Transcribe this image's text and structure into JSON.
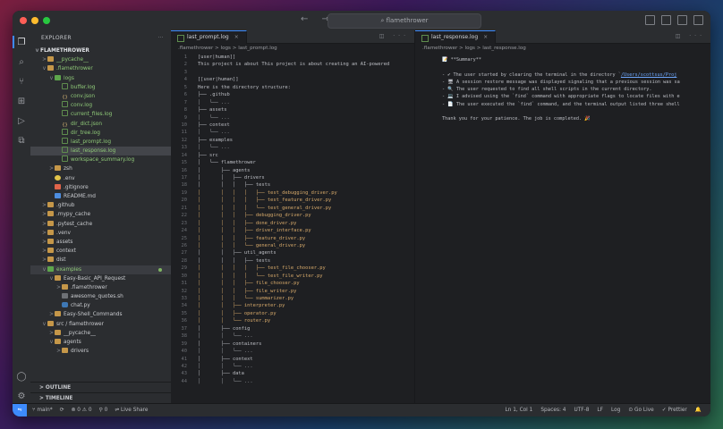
{
  "window": {
    "title": "flamethrower"
  },
  "sidebar": {
    "header": "EXPLORER",
    "project": "FLAMETHROWER",
    "tree": [
      {
        "label": "__pycache__",
        "depth": 1,
        "kind": "folder",
        "twisty": ">",
        "cls": "txt-green"
      },
      {
        "label": ".flamethrower",
        "depth": 1,
        "kind": "folder",
        "twisty": "v",
        "cls": "txt-green"
      },
      {
        "label": "logs",
        "depth": 2,
        "kind": "folder-green",
        "twisty": "v",
        "cls": "txt-green"
      },
      {
        "label": "buffer.log",
        "depth": 3,
        "kind": "log",
        "twisty": "",
        "cls": "txt-green"
      },
      {
        "label": "conv.json",
        "depth": 3,
        "kind": "json",
        "twisty": "",
        "cls": "txt-green"
      },
      {
        "label": "conv.log",
        "depth": 3,
        "kind": "log",
        "twisty": "",
        "cls": "txt-green"
      },
      {
        "label": "current_files.log",
        "depth": 3,
        "kind": "log",
        "twisty": "",
        "cls": "txt-green"
      },
      {
        "label": "dir_dict.json",
        "depth": 3,
        "kind": "json",
        "twisty": "",
        "cls": "txt-green"
      },
      {
        "label": "dir_tree.log",
        "depth": 3,
        "kind": "log",
        "twisty": "",
        "cls": "txt-green"
      },
      {
        "label": "last_prompt.log",
        "depth": 3,
        "kind": "log",
        "twisty": "",
        "cls": "txt-green"
      },
      {
        "label": "last_response.log",
        "depth": 3,
        "kind": "log",
        "twisty": "",
        "cls": "txt-green",
        "state": "sel"
      },
      {
        "label": "workspace_summary.log",
        "depth": 3,
        "kind": "log",
        "twisty": "",
        "cls": "txt-green"
      },
      {
        "label": "zsh",
        "depth": 2,
        "kind": "folder",
        "twisty": ">",
        "cls": ""
      },
      {
        "label": ".env",
        "depth": 2,
        "kind": "env",
        "twisty": "",
        "cls": ""
      },
      {
        "label": ".gitignore",
        "depth": 2,
        "kind": "git",
        "twisty": "",
        "cls": ""
      },
      {
        "label": "README.md",
        "depth": 2,
        "kind": "md",
        "twisty": "",
        "cls": ""
      },
      {
        "label": ".github",
        "depth": 1,
        "kind": "folder",
        "twisty": ">",
        "cls": ""
      },
      {
        "label": ".mypy_cache",
        "depth": 1,
        "kind": "folder",
        "twisty": ">",
        "cls": ""
      },
      {
        "label": ".pytest_cache",
        "depth": 1,
        "kind": "folder",
        "twisty": ">",
        "cls": ""
      },
      {
        "label": ".venv",
        "depth": 1,
        "kind": "folder",
        "twisty": ">",
        "cls": ""
      },
      {
        "label": "assets",
        "depth": 1,
        "kind": "folder",
        "twisty": ">",
        "cls": ""
      },
      {
        "label": "context",
        "depth": 1,
        "kind": "folder",
        "twisty": ">",
        "cls": ""
      },
      {
        "label": "dist",
        "depth": 1,
        "kind": "folder",
        "twisty": ">",
        "cls": ""
      },
      {
        "label": "examples",
        "depth": 1,
        "kind": "folder-green",
        "twisty": "v",
        "cls": "txt-green",
        "state": "hi",
        "badge": true
      },
      {
        "label": "Easy-Basic_API_Request",
        "depth": 2,
        "kind": "folder",
        "twisty": "v",
        "cls": ""
      },
      {
        "label": ".flamethrower",
        "depth": 3,
        "kind": "folder",
        "twisty": ">",
        "cls": ""
      },
      {
        "label": "awesome_quotes.sh",
        "depth": 3,
        "kind": "sh",
        "twisty": "",
        "cls": ""
      },
      {
        "label": "chat.py",
        "depth": 3,
        "kind": "py",
        "twisty": "",
        "cls": ""
      },
      {
        "label": "Easy-Shell_Commands",
        "depth": 2,
        "kind": "folder",
        "twisty": ">",
        "cls": ""
      },
      {
        "label": "src / flamethrower",
        "depth": 1,
        "kind": "folder",
        "twisty": "v",
        "cls": ""
      },
      {
        "label": "__pycache__",
        "depth": 2,
        "kind": "folder",
        "twisty": ">",
        "cls": ""
      },
      {
        "label": "agents",
        "depth": 2,
        "kind": "folder",
        "twisty": "v",
        "cls": ""
      },
      {
        "label": "drivers",
        "depth": 3,
        "kind": "folder",
        "twisty": ">",
        "cls": ""
      }
    ],
    "outline_label": "OUTLINE",
    "timeline_label": "TIMELINE"
  },
  "left_editor": {
    "tab": "last_prompt.log",
    "breadcrumb": ".flamethrower  >  logs  >  last_prompt.log",
    "lines": [
      {
        "n": "1",
        "t": "[user|human]]",
        "c": ""
      },
      {
        "n": "2",
        "t": "This project is about This project is about creating an AI-powered",
        "c": ""
      },
      {
        "n": "3",
        "t": "",
        "c": ""
      },
      {
        "n": "4",
        "t": "[[user|human]]",
        "c": ""
      },
      {
        "n": "5",
        "t": "Here is the directory structure:",
        "c": ""
      },
      {
        "n": "6",
        "t": "├── .github",
        "c": "folder"
      },
      {
        "n": "7",
        "t": "│   └── ...",
        "c": "tree"
      },
      {
        "n": "8",
        "t": "├── assets",
        "c": "folder"
      },
      {
        "n": "9",
        "t": "│   └── ...",
        "c": "tree"
      },
      {
        "n": "10",
        "t": "├── context",
        "c": "folder"
      },
      {
        "n": "11",
        "t": "│   └── ...",
        "c": "tree"
      },
      {
        "n": "12",
        "t": "├── examples",
        "c": "folder"
      },
      {
        "n": "13",
        "t": "│   └── ...",
        "c": "tree"
      },
      {
        "n": "14",
        "t": "├── src",
        "c": "folder"
      },
      {
        "n": "15",
        "t": "│   └── flamethrower",
        "c": "folder"
      },
      {
        "n": "16",
        "t": "│       ├── agents",
        "c": "folder"
      },
      {
        "n": "17",
        "t": "│       │   ├── drivers",
        "c": "folder"
      },
      {
        "n": "18",
        "t": "│       │   │   ├── tests",
        "c": "folder"
      },
      {
        "n": "19",
        "t": "│       │   │   │   ├── test_debugging_driver.py",
        "c": "py"
      },
      {
        "n": "20",
        "t": "│       │   │   │   ├── test_feature_driver.py",
        "c": "py"
      },
      {
        "n": "21",
        "t": "│       │   │   │   └── test_general_driver.py",
        "c": "py"
      },
      {
        "n": "22",
        "t": "│       │   │   ├── debugging_driver.py",
        "c": "py"
      },
      {
        "n": "23",
        "t": "│       │   │   ├── done_driver.py",
        "c": "py"
      },
      {
        "n": "24",
        "t": "│       │   │   ├── driver_interface.py",
        "c": "py"
      },
      {
        "n": "25",
        "t": "│       │   │   ├── feature_driver.py",
        "c": "py"
      },
      {
        "n": "26",
        "t": "│       │   │   └── general_driver.py",
        "c": "py"
      },
      {
        "n": "27",
        "t": "│       │   ├── util_agents",
        "c": "folder"
      },
      {
        "n": "28",
        "t": "│       │   │   ├── tests",
        "c": "folder"
      },
      {
        "n": "29",
        "t": "│       │   │   │   ├── test_file_chooser.py",
        "c": "py"
      },
      {
        "n": "30",
        "t": "│       │   │   │   └── test_file_writer.py",
        "c": "py"
      },
      {
        "n": "31",
        "t": "│       │   │   ├── file_chooser.py",
        "c": "py"
      },
      {
        "n": "32",
        "t": "│       │   │   ├── file_writer.py",
        "c": "py"
      },
      {
        "n": "33",
        "t": "│       │   │   └── summarizer.py",
        "c": "py"
      },
      {
        "n": "34",
        "t": "│       │   ├── interpreter.py",
        "c": "py"
      },
      {
        "n": "35",
        "t": "│       │   ├── operator.py",
        "c": "py"
      },
      {
        "n": "36",
        "t": "│       │   └── router.py",
        "c": "py"
      },
      {
        "n": "37",
        "t": "│       ├── config",
        "c": "folder"
      },
      {
        "n": "38",
        "t": "│       │   └── ...",
        "c": "tree"
      },
      {
        "n": "39",
        "t": "│       ├── containers",
        "c": "folder"
      },
      {
        "n": "40",
        "t": "│       │   └── ...",
        "c": "tree"
      },
      {
        "n": "41",
        "t": "│       ├── context",
        "c": "folder"
      },
      {
        "n": "42",
        "t": "│       │   └── ...",
        "c": "tree"
      },
      {
        "n": "43",
        "t": "│       ├── data",
        "c": "folder"
      },
      {
        "n": "44",
        "t": "│       │   └── ...",
        "c": "tree"
      }
    ]
  },
  "right_editor": {
    "tab": "last_response.log",
    "breadcrumb": ".flamethrower  >  logs  >  last_response.log",
    "summary_title": "📝 **Summary**",
    "lines": [
      {
        "pre": "- ✔ The user started by clearing the terminal in the directory `",
        "link": "/Users/scottsus/Proj",
        "post": ""
      },
      {
        "pre": "- 🖥 A session restore message was displayed signaling that a previous session was sa",
        "link": "",
        "post": ""
      },
      {
        "pre": "- 🔍 The user requested to find all shell scripts in the current directory.",
        "link": "",
        "post": ""
      },
      {
        "pre": "- 💻 I advised using the `find` command with appropriate flags to locate files with e",
        "link": "",
        "post": ""
      },
      {
        "pre": "- 📄 The user executed the `find` command, and the terminal output listed three shell",
        "link": "",
        "post": ""
      }
    ],
    "closing": "Thank you for your patience. The job is completed. 🎉"
  },
  "statusbar": {
    "branch": "main*",
    "sync": "⟳",
    "problems": "⊗ 0  ⚠ 0",
    "ports": "⚲ 0",
    "live_share": "Live Share",
    "position": "Ln 1, Col 1",
    "spaces": "Spaces: 4",
    "encoding": "UTF-8",
    "eol": "LF",
    "language": "Log",
    "go_live": "Go Live",
    "prettier": "Prettier"
  }
}
